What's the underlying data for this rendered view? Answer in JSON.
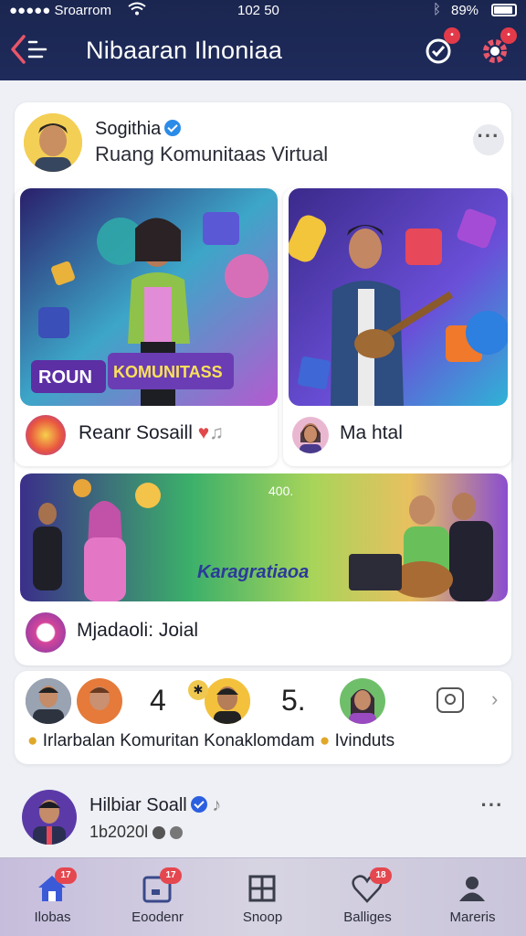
{
  "status_bar": {
    "carrier": "●●●●● Sroarrom",
    "time": "102 50",
    "battery": "89%"
  },
  "header": {
    "title": "Nibaaran Ilnoniaa"
  },
  "post": {
    "author": "Sogithia",
    "subtitle": "Ruang Komunitaas Virtual",
    "tiles": [
      {
        "banner_left": "ROUN",
        "banner_right": "KOMUNITASS",
        "label": "Reanr Sosaill"
      },
      {
        "label": "Ma htal"
      }
    ],
    "wide_tile": {
      "banner": "Karagratiaoa",
      "tag": "400.",
      "label": "Mjadaoli: Joial"
    }
  },
  "people_strip": {
    "count_a": "4",
    "count_b": "5.",
    "text": "Irlarbalan Komuritan Konaklomdam",
    "text_end": "Ivinduts"
  },
  "post2": {
    "name": "Hilbiar Soall",
    "sub": "1b2020l"
  },
  "nav": [
    {
      "label": "Ilobas",
      "badge": "17"
    },
    {
      "label": "Eoodenr",
      "badge": "17"
    },
    {
      "label": "Snoop",
      "badge": ""
    },
    {
      "label": "Balliges",
      "badge": "18"
    },
    {
      "label": "Mareris",
      "badge": ""
    }
  ],
  "colors": {
    "header_bg": "#1b2650",
    "accent_badge": "#e33a4a",
    "verified": "#2b8be8"
  }
}
